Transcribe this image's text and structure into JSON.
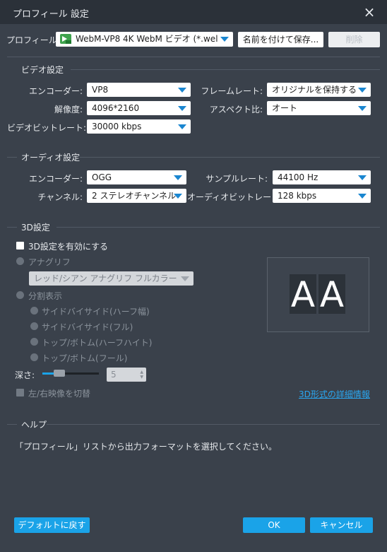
{
  "window": {
    "title": "プロフィール 設定",
    "close_icon": "×"
  },
  "profile": {
    "label": "プロフィール:",
    "value": "WebM-VP8 4K WebM ビデオ (*.wel",
    "icon": "webm-icon",
    "save_as_label": "名前を付けて保存...",
    "delete_label": "削除"
  },
  "video": {
    "section_title": "ビデオ設定",
    "encoder_label": "エンコーダー:",
    "encoder_value": "VP8",
    "resolution_label": "解像度:",
    "resolution_value": "4096*2160",
    "bitrate_label": "ビデオビットレート:",
    "bitrate_value": "30000 kbps",
    "framerate_label": "フレームレート:",
    "framerate_value": "オリジナルを保持する",
    "aspect_label": "アスペクト比:",
    "aspect_value": "オート"
  },
  "audio": {
    "section_title": "オーディオ設定",
    "encoder_label": "エンコーダー:",
    "encoder_value": "OGG",
    "channel_label": "チャンネル:",
    "channel_value": "2 ステレオチャンネル",
    "samplerate_label": "サンプルレート:",
    "samplerate_value": "44100 Hz",
    "bitrate_label": "オーディオビットレート:",
    "bitrate_value": "128 kbps"
  },
  "three_d": {
    "section_title": "3D設定",
    "enable_label": "3D設定を有効にする",
    "enabled": false,
    "anaglyph_label": "アナグリフ",
    "anaglyph_value": "レッド/シアン アナグリフ フルカラー",
    "split_label": "分割表示",
    "split_options": [
      "サイドバイサイド(ハーフ幅)",
      "サイドバイサイド(フル)",
      "トップ/ボトム(ハーフハイト)",
      "トップ/ボトム(フール)"
    ],
    "depth_label": "深さ:",
    "depth_value": "5",
    "depth_level": 0.25,
    "swap_label": "左/右映像を切替",
    "details_link": "3D形式の詳細情報",
    "preview_letters": [
      "A",
      "A"
    ]
  },
  "help": {
    "section_title": "ヘルプ",
    "text": "「プロフィール」リストから出力フォーマットを選択してください。"
  },
  "footer": {
    "default_label": "デフォルトに戻す",
    "ok_label": "OK",
    "cancel_label": "キャンセル"
  },
  "colors": {
    "background": "#3a414b",
    "titlebar": "#2b3139",
    "accent": "#1aa3e8",
    "link": "#2aa6f0"
  }
}
